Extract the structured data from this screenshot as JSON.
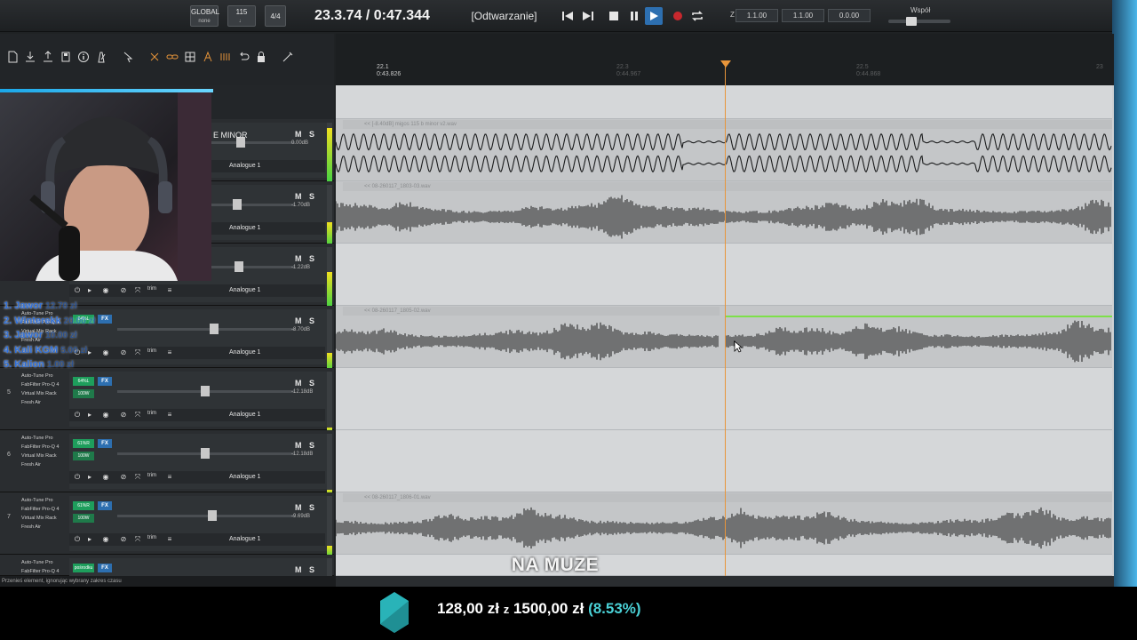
{
  "transport": {
    "global_label": "GLOBAL",
    "global_sub": "none",
    "tempo": "115",
    "meter": "4/4",
    "time": "23.3.74 / 0:47.344",
    "status": "[Odtwarzanie]",
    "values": [
      "1.1.00",
      "1.1.00",
      "0.0.00"
    ],
    "z_label": "Z",
    "wspol_label": "Współ"
  },
  "ruler": {
    "marks": [
      {
        "bar": "22.1",
        "time": "0:43.826"
      },
      {
        "bar": "22.3",
        "time": "0:44.967"
      },
      {
        "bar": "22.5",
        "time": "0:44.868"
      },
      {
        "bar": "23",
        "time": ""
      }
    ]
  },
  "tracks": [
    {
      "num": "",
      "name": "E MINOR",
      "fx": [],
      "db": "0.00dB",
      "analog": "Analogue 1",
      "clip": "<< [-8.40dB] migos 115 b minor v2.wav"
    },
    {
      "num": "",
      "name": "",
      "fx": [],
      "db": "-1.70dB",
      "analog": "Analogue 1",
      "clip": "<< 08-260117_1803-03.wav"
    },
    {
      "num": "",
      "name": "",
      "fx": [
        "Fresh Air"
      ],
      "db": "-1.22dB",
      "analog": "Analogue 1",
      "clip": ""
    },
    {
      "num": "",
      "name": "",
      "fx": [
        "Auto-Tune Pro",
        "FabFilter Pro-Q 4",
        "Virtual Mix Rack",
        "Fresh Air"
      ],
      "plug": "64%L",
      "db": "-8.70dB",
      "analog": "Analogue 1",
      "clip": "<< 08-260117_1805-02.wav"
    },
    {
      "num": "5",
      "name": "",
      "fx": [
        "Auto-Tune Pro",
        "FabFilter Pro-Q 4",
        "Virtual Mix Rack",
        "Fresh Air"
      ],
      "plug": "64%L",
      "plug2": "100W",
      "db": "-12.18dB",
      "analog": "Analogue 1",
      "clip": ""
    },
    {
      "num": "6",
      "name": "",
      "fx": [
        "Auto-Tune Pro",
        "FabFilter Pro-Q 4",
        "Virtual Mix Rack",
        "Fresh Air"
      ],
      "plug": "61%R",
      "plug2": "100W",
      "db": "-12.18dB",
      "analog": "Analogue 1",
      "clip": ""
    },
    {
      "num": "7",
      "name": "",
      "fx": [
        "Auto-Tune Pro",
        "FabFilter Pro-Q 4",
        "Virtual Mix Rack",
        "Fresh Air"
      ],
      "plug": "61%R",
      "plug2": "100W",
      "db": "-9.69dB",
      "analog": "Analogue 1",
      "clip": "<< 08-260117_1806-01.wav"
    },
    {
      "num": "",
      "name": "",
      "fx": [
        "Auto-Tune Pro",
        "FabFilter Pro-Q 4"
      ],
      "plug": "pośrodku",
      "db": "",
      "analog": "",
      "clip": ""
    }
  ],
  "ctrl_labels": {
    "trim": "trim",
    "fx": "FX"
  },
  "donors": [
    {
      "name": "1. Jawor",
      "amount": "12.70 zł"
    },
    {
      "name": "2. Winterekk",
      "amount": "20.00 zł"
    },
    {
      "name": "3. Jawor",
      "amount": "10.00 zł"
    },
    {
      "name": "4. Kali KGM",
      "amount": "5.00 zł"
    },
    {
      "name": "5. Kalion",
      "amount": "1.00 zł"
    }
  ],
  "caption": "NA MUZE",
  "status_bar": "Przenieś element, ignorując wybrany zakres czasu",
  "goal": {
    "current": "128,00 zł",
    "sep": "z",
    "target": "1500,00 zł",
    "percent": "(8.53%)",
    "fraction": 0.0853
  },
  "colors": {
    "accent": "#2d6fb0",
    "playhead": "#e8953a",
    "goal": "#4ad1d6",
    "donor": "#2f6fd8"
  }
}
